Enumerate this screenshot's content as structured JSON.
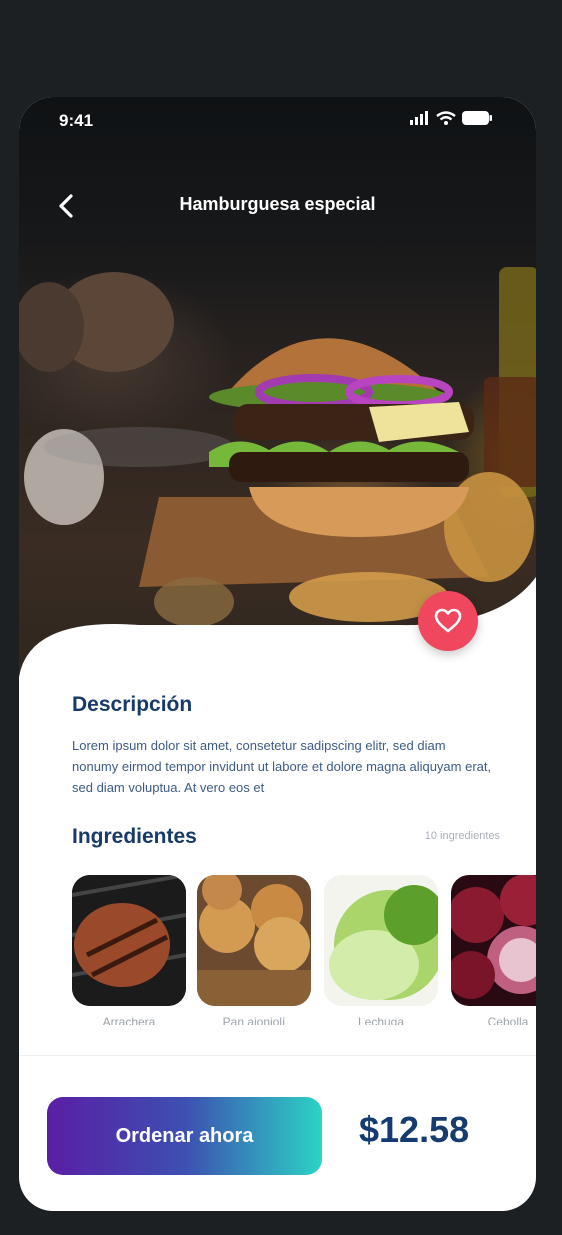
{
  "status_bar": {
    "time": "9:41"
  },
  "header": {
    "title": "Hamburguesa especial"
  },
  "description": {
    "heading": "Descripción",
    "text": "Lorem ipsum dolor sit amet, consetetur sadipscing elitr, sed diam nonumy eirmod tempor invidunt ut labore et dolore magna aliquyam erat, sed diam voluptua. At vero eos et"
  },
  "ingredients": {
    "heading": "Ingredientes",
    "count": "10 ingredientes",
    "items": [
      {
        "label": "Arrachera"
      },
      {
        "label": "Pan ajonjolí"
      },
      {
        "label": "Lechuga"
      },
      {
        "label": "Cebolla"
      }
    ]
  },
  "order": {
    "button_label": "Ordenar ahora",
    "price": "$12.58"
  },
  "colors": {
    "accent_heart": "#f0475e",
    "title_blue": "#173a6b",
    "gradient_start": "#5a1ea6",
    "gradient_end": "#2cd3c5"
  }
}
